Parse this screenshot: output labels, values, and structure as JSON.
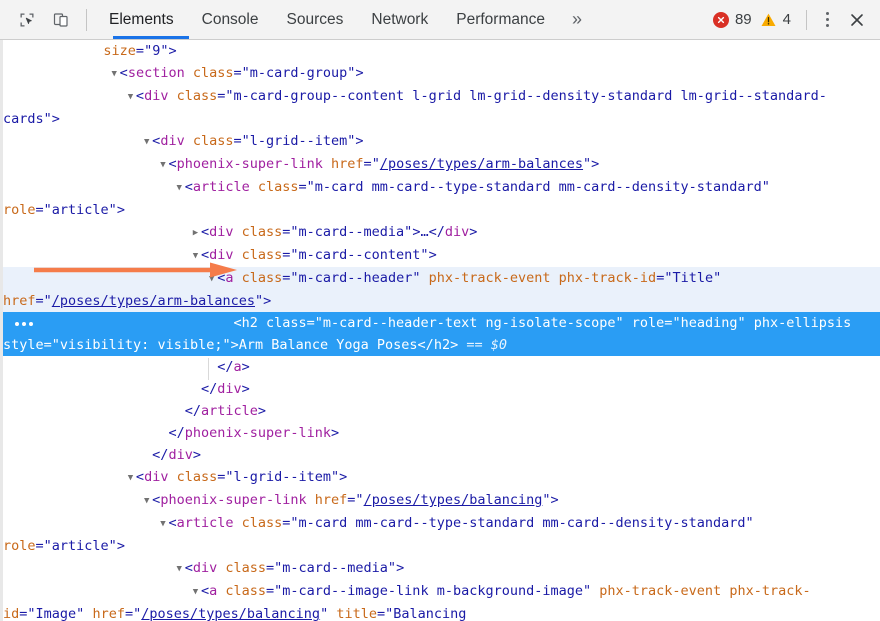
{
  "toolbar": {
    "icons": [
      {
        "name": "inspect-element-icon",
        "label": "Inspect element"
      },
      {
        "name": "device-toolbar-icon",
        "label": "Toggle device toolbar"
      }
    ],
    "tabs": [
      {
        "label": "Elements",
        "active": true
      },
      {
        "label": "Console",
        "active": false
      },
      {
        "label": "Sources",
        "active": false
      },
      {
        "label": "Network",
        "active": false
      },
      {
        "label": "Performance",
        "active": false
      }
    ],
    "more_tabs_label": "»",
    "error_count": "89",
    "warning_count": "4",
    "error_color": "#d93025",
    "warning_color": "#f9ab00",
    "active_tab_underline_color": "#1a73e8",
    "kebab_label": "Customize and control DevTools",
    "close_label": "✕"
  },
  "annotation": {
    "arrow_color": "#f57c4a",
    "points_to": "m-card--header anchor line"
  },
  "tree": {
    "selected_suffix": "== $0",
    "lines": [
      {
        "id": "line-1",
        "indent": 11,
        "twisty": "none",
        "state": "normal",
        "segments": [
          {
            "cls": "attr",
            "text": "size"
          },
          {
            "cls": "punct",
            "text": "="
          },
          {
            "cls": "val",
            "text": "\"9\""
          },
          {
            "cls": "punct",
            "text": ">"
          }
        ]
      },
      {
        "id": "line-2",
        "indent": 13,
        "twisty": "open",
        "state": "normal",
        "segments": [
          {
            "cls": "punct",
            "text": "<"
          },
          {
            "cls": "tag",
            "text": "section"
          },
          {
            "cls": "punct",
            "text": " "
          },
          {
            "cls": "attr",
            "text": "class"
          },
          {
            "cls": "punct",
            "text": "="
          },
          {
            "cls": "val",
            "text": "\"m-card-group\""
          },
          {
            "cls": "punct",
            "text": ">"
          }
        ]
      },
      {
        "id": "line-3",
        "indent": 15,
        "twisty": "open",
        "state": "normal",
        "segments": [
          {
            "cls": "punct",
            "text": "<"
          },
          {
            "cls": "tag",
            "text": "div"
          },
          {
            "cls": "punct",
            "text": " "
          },
          {
            "cls": "attr",
            "text": "class"
          },
          {
            "cls": "punct",
            "text": "="
          },
          {
            "cls": "val",
            "text": "\"m-card-group--content l-grid lm-grid--density-standard lm-grid--standard-cards\""
          },
          {
            "cls": "punct",
            "text": ">"
          }
        ]
      },
      {
        "id": "line-4",
        "indent": 17,
        "twisty": "open",
        "state": "normal",
        "segments": [
          {
            "cls": "punct",
            "text": "<"
          },
          {
            "cls": "tag",
            "text": "div"
          },
          {
            "cls": "punct",
            "text": " "
          },
          {
            "cls": "attr",
            "text": "class"
          },
          {
            "cls": "punct",
            "text": "="
          },
          {
            "cls": "val",
            "text": "\"l-grid--item\""
          },
          {
            "cls": "punct",
            "text": ">"
          }
        ]
      },
      {
        "id": "line-5",
        "indent": 19,
        "twisty": "open",
        "state": "normal",
        "segments": [
          {
            "cls": "punct",
            "text": "<"
          },
          {
            "cls": "tag",
            "text": "phoenix-super-link"
          },
          {
            "cls": "punct",
            "text": " "
          },
          {
            "cls": "attr",
            "text": "href"
          },
          {
            "cls": "punct",
            "text": "="
          },
          {
            "cls": "punct",
            "text": "\""
          },
          {
            "cls": "link",
            "text": "/poses/types/arm-balances"
          },
          {
            "cls": "punct",
            "text": "\">"
          }
        ]
      },
      {
        "id": "line-6",
        "indent": 21,
        "twisty": "open",
        "state": "normal",
        "segments": [
          {
            "cls": "punct",
            "text": "<"
          },
          {
            "cls": "tag",
            "text": "article"
          },
          {
            "cls": "punct",
            "text": " "
          },
          {
            "cls": "attr",
            "text": "class"
          },
          {
            "cls": "punct",
            "text": "="
          },
          {
            "cls": "val",
            "text": "\"m-card mm-card--type-standard mm-card--density-standard\""
          },
          {
            "cls": "punct",
            "text": " "
          },
          {
            "cls": "attr",
            "text": "role"
          },
          {
            "cls": "punct",
            "text": "="
          },
          {
            "cls": "val",
            "text": "\"article\""
          },
          {
            "cls": "punct",
            "text": ">"
          }
        ]
      },
      {
        "id": "line-7",
        "indent": 23,
        "twisty": "closed",
        "state": "normal",
        "segments": [
          {
            "cls": "punct",
            "text": "<"
          },
          {
            "cls": "tag",
            "text": "div"
          },
          {
            "cls": "punct",
            "text": " "
          },
          {
            "cls": "attr",
            "text": "class"
          },
          {
            "cls": "punct",
            "text": "="
          },
          {
            "cls": "val",
            "text": "\"m-card--media\""
          },
          {
            "cls": "punct",
            "text": ">"
          },
          {
            "cls": "txt",
            "text": "…"
          },
          {
            "cls": "punct",
            "text": "</"
          },
          {
            "cls": "tag",
            "text": "div"
          },
          {
            "cls": "punct",
            "text": ">"
          }
        ]
      },
      {
        "id": "line-8",
        "indent": 23,
        "twisty": "open",
        "state": "normal",
        "segments": [
          {
            "cls": "punct",
            "text": "<"
          },
          {
            "cls": "tag",
            "text": "div"
          },
          {
            "cls": "punct",
            "text": " "
          },
          {
            "cls": "attr",
            "text": "class"
          },
          {
            "cls": "punct",
            "text": "="
          },
          {
            "cls": "val",
            "text": "\"m-card--content\""
          },
          {
            "cls": "punct",
            "text": ">"
          }
        ]
      },
      {
        "id": "line-9",
        "indent": 25,
        "twisty": "open",
        "state": "hover",
        "segments": [
          {
            "cls": "punct",
            "text": "<"
          },
          {
            "cls": "tag",
            "text": "a"
          },
          {
            "cls": "punct",
            "text": " "
          },
          {
            "cls": "attr",
            "text": "class"
          },
          {
            "cls": "punct",
            "text": "="
          },
          {
            "cls": "val",
            "text": "\"m-card--header\""
          },
          {
            "cls": "punct",
            "text": " "
          },
          {
            "cls": "attr",
            "text": "phx-track-event"
          },
          {
            "cls": "punct",
            "text": " "
          },
          {
            "cls": "attr",
            "text": "phx-track-id"
          },
          {
            "cls": "punct",
            "text": "="
          },
          {
            "cls": "val",
            "text": "\"Title\""
          },
          {
            "cls": "punct",
            "text": " "
          },
          {
            "cls": "attr",
            "text": "href"
          },
          {
            "cls": "punct",
            "text": "="
          },
          {
            "cls": "punct",
            "text": "\""
          },
          {
            "cls": "link",
            "text": "/poses/types/arm-balances"
          },
          {
            "cls": "punct",
            "text": "\">"
          }
        ]
      },
      {
        "id": "line-10",
        "indent": 27,
        "twisty": "none",
        "state": "selected",
        "segments": [
          {
            "cls": "punct",
            "text": "<"
          },
          {
            "cls": "tag",
            "text": "h2"
          },
          {
            "cls": "punct",
            "text": " "
          },
          {
            "cls": "attr",
            "text": "class"
          },
          {
            "cls": "punct",
            "text": "="
          },
          {
            "cls": "val",
            "text": "\"m-card--header-text ng-isolate-scope\""
          },
          {
            "cls": "punct",
            "text": " "
          },
          {
            "cls": "attr",
            "text": "role"
          },
          {
            "cls": "punct",
            "text": "="
          },
          {
            "cls": "val",
            "text": "\"heading\""
          },
          {
            "cls": "punct",
            "text": " "
          },
          {
            "cls": "attr",
            "text": "phx-ellipsis"
          },
          {
            "cls": "punct",
            "text": " "
          },
          {
            "cls": "attr",
            "text": "style"
          },
          {
            "cls": "punct",
            "text": "="
          },
          {
            "cls": "val",
            "text": "\"visibility: visible;\""
          },
          {
            "cls": "punct",
            "text": ">"
          },
          {
            "cls": "txt",
            "text": "Arm Balance Yoga Poses"
          },
          {
            "cls": "punct",
            "text": "</"
          },
          {
            "cls": "tag",
            "text": "h2"
          },
          {
            "cls": "punct",
            "text": ">"
          },
          {
            "cls": "dollar",
            "text": " == $0"
          }
        ]
      },
      {
        "id": "line-11",
        "indent": 25,
        "twisty": "none",
        "state": "normal",
        "segments": [
          {
            "cls": "punct",
            "text": "</"
          },
          {
            "cls": "tag",
            "text": "a"
          },
          {
            "cls": "punct",
            "text": ">"
          }
        ]
      },
      {
        "id": "line-12",
        "indent": 23,
        "twisty": "none",
        "state": "normal",
        "segments": [
          {
            "cls": "punct",
            "text": "</"
          },
          {
            "cls": "tag",
            "text": "div"
          },
          {
            "cls": "punct",
            "text": ">"
          }
        ]
      },
      {
        "id": "line-13",
        "indent": 21,
        "twisty": "none",
        "state": "normal",
        "segments": [
          {
            "cls": "punct",
            "text": "</"
          },
          {
            "cls": "tag",
            "text": "article"
          },
          {
            "cls": "punct",
            "text": ">"
          }
        ]
      },
      {
        "id": "line-14",
        "indent": 19,
        "twisty": "none",
        "state": "normal",
        "segments": [
          {
            "cls": "punct",
            "text": "</"
          },
          {
            "cls": "tag",
            "text": "phoenix-super-link"
          },
          {
            "cls": "punct",
            "text": ">"
          }
        ]
      },
      {
        "id": "line-15",
        "indent": 17,
        "twisty": "none",
        "state": "normal",
        "segments": [
          {
            "cls": "punct",
            "text": "</"
          },
          {
            "cls": "tag",
            "text": "div"
          },
          {
            "cls": "punct",
            "text": ">"
          }
        ]
      },
      {
        "id": "line-16",
        "indent": 15,
        "twisty": "open",
        "state": "normal",
        "segments": [
          {
            "cls": "punct",
            "text": "<"
          },
          {
            "cls": "tag",
            "text": "div"
          },
          {
            "cls": "punct",
            "text": " "
          },
          {
            "cls": "attr",
            "text": "class"
          },
          {
            "cls": "punct",
            "text": "="
          },
          {
            "cls": "val",
            "text": "\"l-grid--item\""
          },
          {
            "cls": "punct",
            "text": ">"
          }
        ]
      },
      {
        "id": "line-17",
        "indent": 17,
        "twisty": "open",
        "state": "normal",
        "segments": [
          {
            "cls": "punct",
            "text": "<"
          },
          {
            "cls": "tag",
            "text": "phoenix-super-link"
          },
          {
            "cls": "punct",
            "text": " "
          },
          {
            "cls": "attr",
            "text": "href"
          },
          {
            "cls": "punct",
            "text": "="
          },
          {
            "cls": "punct",
            "text": "\""
          },
          {
            "cls": "link",
            "text": "/poses/types/balancing"
          },
          {
            "cls": "punct",
            "text": "\">"
          }
        ]
      },
      {
        "id": "line-18",
        "indent": 19,
        "twisty": "open",
        "state": "normal",
        "segments": [
          {
            "cls": "punct",
            "text": "<"
          },
          {
            "cls": "tag",
            "text": "article"
          },
          {
            "cls": "punct",
            "text": " "
          },
          {
            "cls": "attr",
            "text": "class"
          },
          {
            "cls": "punct",
            "text": "="
          },
          {
            "cls": "val",
            "text": "\"m-card mm-card--type-standard mm-card--density-standard\""
          },
          {
            "cls": "punct",
            "text": " "
          },
          {
            "cls": "attr",
            "text": "role"
          },
          {
            "cls": "punct",
            "text": "="
          },
          {
            "cls": "val",
            "text": "\"article\""
          },
          {
            "cls": "punct",
            "text": ">"
          }
        ]
      },
      {
        "id": "line-19",
        "indent": 21,
        "twisty": "open",
        "state": "normal",
        "segments": [
          {
            "cls": "punct",
            "text": "<"
          },
          {
            "cls": "tag",
            "text": "div"
          },
          {
            "cls": "punct",
            "text": " "
          },
          {
            "cls": "attr",
            "text": "class"
          },
          {
            "cls": "punct",
            "text": "="
          },
          {
            "cls": "val",
            "text": "\"m-card--media\""
          },
          {
            "cls": "punct",
            "text": ">"
          }
        ]
      },
      {
        "id": "line-20",
        "indent": 23,
        "twisty": "open",
        "state": "normal",
        "segments": [
          {
            "cls": "punct",
            "text": "<"
          },
          {
            "cls": "tag",
            "text": "a"
          },
          {
            "cls": "punct",
            "text": " "
          },
          {
            "cls": "attr",
            "text": "class"
          },
          {
            "cls": "punct",
            "text": "="
          },
          {
            "cls": "val",
            "text": "\"m-card--image-link m-background-image\""
          },
          {
            "cls": "punct",
            "text": " "
          },
          {
            "cls": "attr",
            "text": "phx-track-event"
          },
          {
            "cls": "punct",
            "text": " "
          },
          {
            "cls": "attr",
            "text": "phx-track-id"
          },
          {
            "cls": "punct",
            "text": "="
          },
          {
            "cls": "val",
            "text": "\"Image\""
          },
          {
            "cls": "punct",
            "text": " "
          },
          {
            "cls": "attr",
            "text": "href"
          },
          {
            "cls": "punct",
            "text": "="
          },
          {
            "cls": "punct",
            "text": "\""
          },
          {
            "cls": "link",
            "text": "/poses/types/balancing"
          },
          {
            "cls": "punct",
            "text": "\""
          },
          {
            "cls": "punct",
            "text": " "
          },
          {
            "cls": "attr",
            "text": "title"
          },
          {
            "cls": "punct",
            "text": "="
          },
          {
            "cls": "val",
            "text": "\"Balancing"
          }
        ]
      }
    ]
  }
}
